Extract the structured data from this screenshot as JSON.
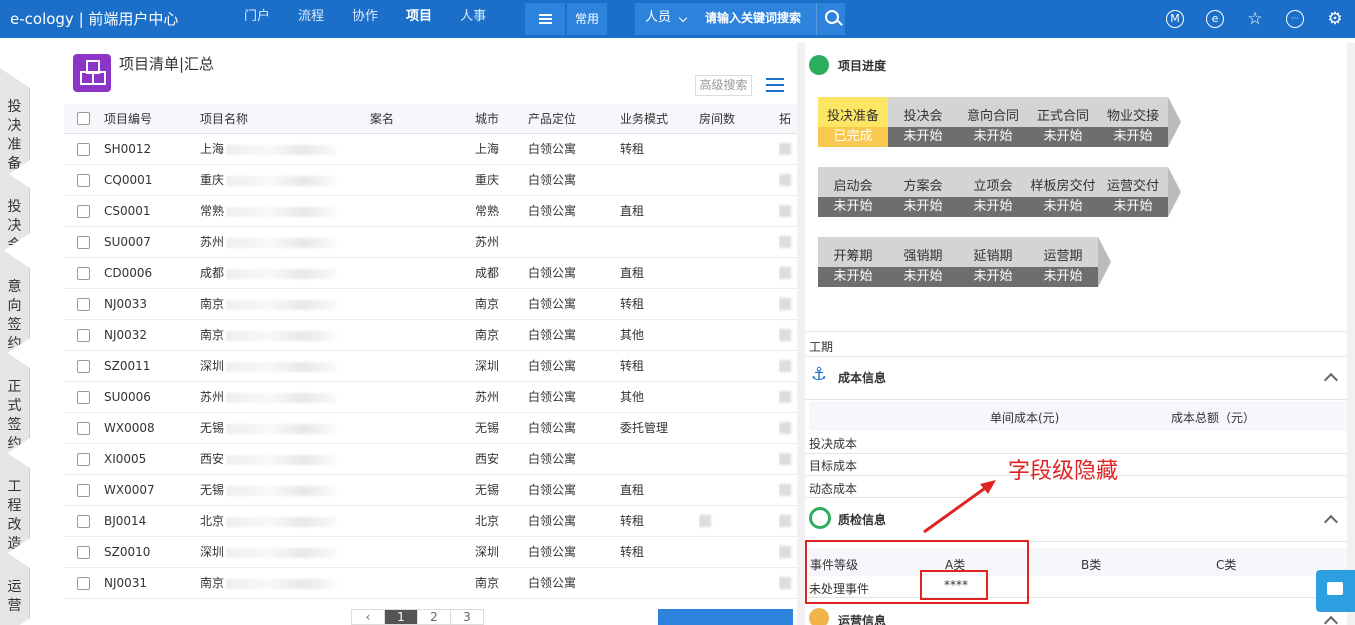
{
  "topbar": {
    "brand": "e-cology | 前端用户中心",
    "nav": [
      "门户",
      "流程",
      "协作",
      "项目",
      "人事"
    ],
    "active_nav": "项目",
    "common_label": "常用",
    "search_type": "人员",
    "search_placeholder": "请输入关键词搜索",
    "icons": [
      "m-icon",
      "e-icon",
      "star-icon",
      "more-icon",
      "settings-icon"
    ],
    "icon_glyphs": [
      "M",
      "e",
      "☆",
      "···",
      "⚙"
    ]
  },
  "vtabs": [
    "投决准备",
    "投决会",
    "意向签约",
    "正式签约",
    "工程改造",
    "运营"
  ],
  "list": {
    "title": "项目清单|汇总",
    "adv_search": "高级搜索",
    "columns": [
      "项目编号",
      "项目名称",
      "案名",
      "城市",
      "产品定位",
      "业务模式",
      "房间数",
      "拓"
    ],
    "rows": [
      {
        "code": "SH0012",
        "name": "上海",
        "city": "上海",
        "pos": "白领公寓",
        "mode": "转租"
      },
      {
        "code": "CQ0001",
        "name": "重庆",
        "city": "重庆",
        "pos": "白领公寓",
        "mode": ""
      },
      {
        "code": "CS0001",
        "name": "常熟",
        "city": "常熟",
        "pos": "白领公寓",
        "mode": "直租"
      },
      {
        "code": "SU0007",
        "name": "苏州",
        "city": "苏州",
        "pos": "",
        "mode": ""
      },
      {
        "code": "CD0006",
        "name": "成都",
        "city": "成都",
        "pos": "白领公寓",
        "mode": "直租"
      },
      {
        "code": "NJ0033",
        "name": "南京",
        "city": "南京",
        "pos": "白领公寓",
        "mode": "转租"
      },
      {
        "code": "NJ0032",
        "name": "南京",
        "city": "南京",
        "pos": "白领公寓",
        "mode": "其他"
      },
      {
        "code": "SZ0011",
        "name": "深圳",
        "city": "深圳",
        "pos": "白领公寓",
        "mode": "转租"
      },
      {
        "code": "SU0006",
        "name": "苏州",
        "city": "苏州",
        "pos": "白领公寓",
        "mode": "其他"
      },
      {
        "code": "WX0008",
        "name": "无锡",
        "city": "无锡",
        "pos": "白领公寓",
        "mode": "委托管理"
      },
      {
        "code": "XI0005",
        "name": "西安",
        "city": "西安",
        "pos": "白领公寓",
        "mode": ""
      },
      {
        "code": "WX0007",
        "name": "无锡",
        "city": "无锡",
        "pos": "白领公寓",
        "mode": "直租"
      },
      {
        "code": "BJ0014",
        "name": "北京",
        "city": "北京",
        "pos": "白领公寓",
        "mode": "转租"
      },
      {
        "code": "SZ0010",
        "name": "深圳",
        "city": "深圳",
        "pos": "白领公寓",
        "mode": "转租"
      },
      {
        "code": "NJ0031",
        "name": "南京",
        "city": "南京",
        "pos": "白领公寓",
        "mode": ""
      }
    ],
    "pager": [
      "1",
      "2",
      "3"
    ]
  },
  "progress": {
    "title": "项目进度",
    "groups": [
      [
        {
          "name": "投决准备",
          "status": "已完成",
          "done": true
        },
        {
          "name": "投决会",
          "status": "未开始"
        },
        {
          "name": "意向合同",
          "status": "未开始"
        },
        {
          "name": "正式合同",
          "status": "未开始"
        },
        {
          "name": "物业交接",
          "status": "未开始"
        }
      ],
      [
        {
          "name": "启动会",
          "status": "未开始"
        },
        {
          "name": "方案会",
          "status": "未开始"
        },
        {
          "name": "立项会",
          "status": "未开始"
        },
        {
          "name": "样板房交付",
          "status": "未开始"
        },
        {
          "name": "运营交付",
          "status": "未开始"
        }
      ],
      [
        {
          "name": "开筹期",
          "status": "未开始"
        },
        {
          "name": "强销期",
          "status": "未开始"
        },
        {
          "name": "延销期",
          "status": "未开始"
        },
        {
          "name": "运营期",
          "status": "未开始"
        }
      ]
    ],
    "period_label": "工期"
  },
  "cost": {
    "title": "成本信息",
    "col_unit": "单间成本(元)",
    "col_total": "成本总额（元）",
    "rows": [
      "投决成本",
      "目标成本",
      "动态成本"
    ]
  },
  "quality": {
    "title": "质检信息",
    "header": [
      "事件等级",
      "A类",
      "B类",
      "C类"
    ],
    "row_label": "未处理事件",
    "row_value": "****"
  },
  "ops": {
    "title": "运营信息"
  },
  "annotation": {
    "text": "字段级隐藏",
    "color": "#e02424"
  }
}
